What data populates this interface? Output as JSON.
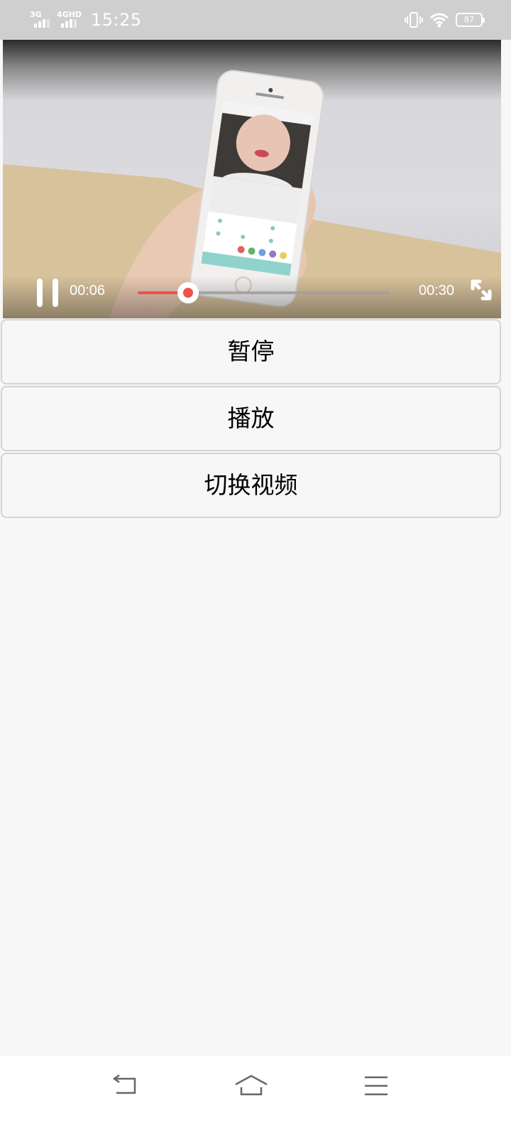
{
  "status_bar": {
    "network1": "3G",
    "network2": "4GHD",
    "time": "15:25",
    "battery": "87",
    "icons": [
      "vibrate-icon",
      "wifi-icon",
      "battery-icon"
    ]
  },
  "video": {
    "current_time": "00:06",
    "duration": "00:30",
    "progress_percent": 20,
    "accent_color": "#f0504a"
  },
  "buttons": {
    "pause_label": "暂停",
    "play_label": "播放",
    "switch_label": "切换视频"
  },
  "nav_bar": {
    "icons": [
      "back-icon",
      "home-icon",
      "menu-icon"
    ]
  }
}
